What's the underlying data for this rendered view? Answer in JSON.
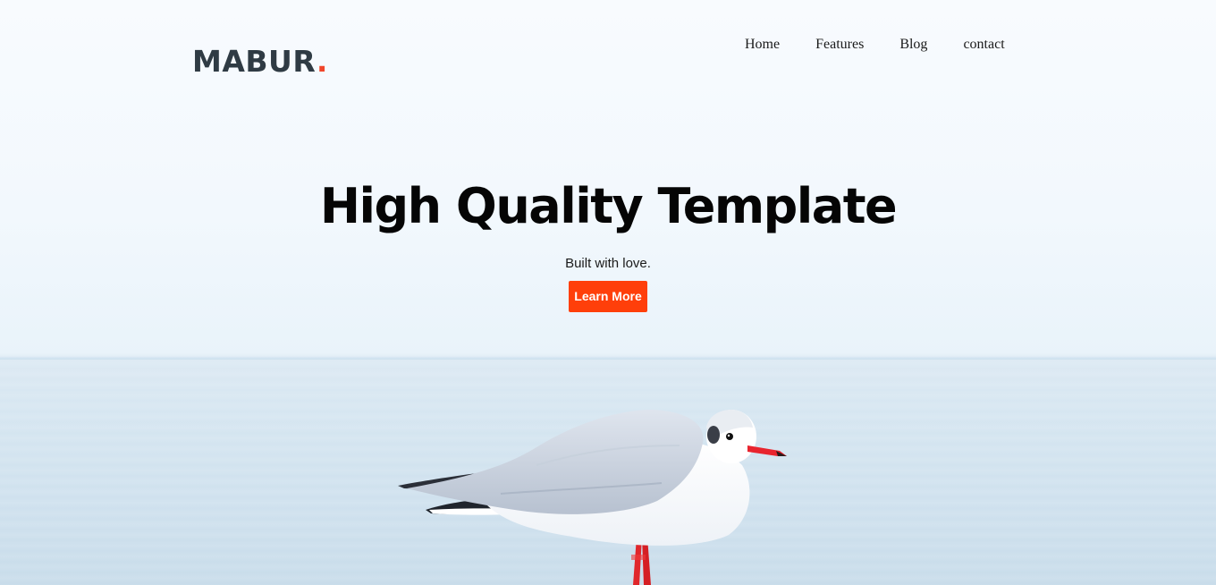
{
  "site": {
    "logo_text": "MABUR",
    "logo_dot": ".",
    "accent_color": "#f0462b"
  },
  "nav": {
    "items": [
      {
        "label": "Home"
      },
      {
        "label": "Features"
      },
      {
        "label": "Blog"
      },
      {
        "label": "contact"
      }
    ]
  },
  "hero": {
    "title": "High Quality Template",
    "subtitle": "Built with love.",
    "cta_label": "Learn More",
    "cta_color": "#ff3f0a",
    "image": "seagull-over-sea"
  }
}
